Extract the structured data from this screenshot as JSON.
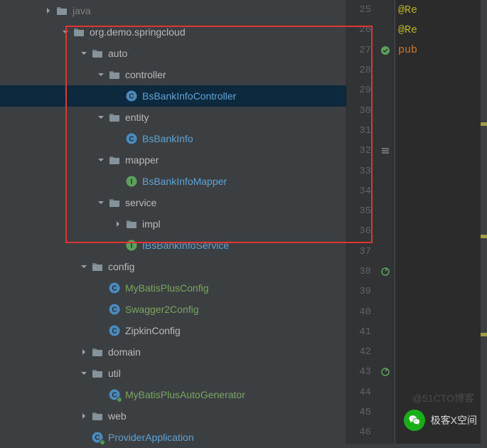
{
  "tree": {
    "rows": [
      {
        "indent": 62,
        "arrow": "right",
        "icon": "folder",
        "label": "java",
        "cls": "dim",
        "sel": false
      },
      {
        "indent": 86,
        "arrow": "down",
        "icon": "folder",
        "label": "org.demo.springcloud",
        "cls": "",
        "sel": false
      },
      {
        "indent": 112,
        "arrow": "down",
        "icon": "folder",
        "label": "auto",
        "cls": "",
        "sel": false
      },
      {
        "indent": 136,
        "arrow": "down",
        "icon": "folder",
        "label": "controller",
        "cls": "",
        "sel": false
      },
      {
        "indent": 160,
        "arrow": "none",
        "icon": "class",
        "label": "BsBankInfoController",
        "cls": "svc",
        "sel": true
      },
      {
        "indent": 136,
        "arrow": "down",
        "icon": "folder",
        "label": "entity",
        "cls": "",
        "sel": false
      },
      {
        "indent": 160,
        "arrow": "none",
        "icon": "class",
        "label": "BsBankInfo",
        "cls": "svc",
        "sel": false
      },
      {
        "indent": 136,
        "arrow": "down",
        "icon": "folder",
        "label": "mapper",
        "cls": "",
        "sel": false
      },
      {
        "indent": 160,
        "arrow": "none",
        "icon": "iface",
        "label": "BsBankInfoMapper",
        "cls": "svc",
        "sel": false
      },
      {
        "indent": 136,
        "arrow": "down",
        "icon": "folder",
        "label": "service",
        "cls": "",
        "sel": false
      },
      {
        "indent": 160,
        "arrow": "right",
        "icon": "folder",
        "label": "impl",
        "cls": "",
        "sel": false
      },
      {
        "indent": 160,
        "arrow": "none",
        "icon": "iface",
        "label": "IBsBankInfoService",
        "cls": "svc",
        "sel": false
      },
      {
        "indent": 112,
        "arrow": "down",
        "icon": "folder",
        "label": "config",
        "cls": "",
        "sel": false
      },
      {
        "indent": 136,
        "arrow": "none",
        "icon": "class",
        "label": "MyBatisPlusConfig",
        "cls": "green",
        "sel": false
      },
      {
        "indent": 136,
        "arrow": "none",
        "icon": "class",
        "label": "Swagger2Config",
        "cls": "green",
        "sel": false
      },
      {
        "indent": 136,
        "arrow": "none",
        "icon": "class",
        "label": "ZipkinConfig",
        "cls": "",
        "sel": false
      },
      {
        "indent": 112,
        "arrow": "right",
        "icon": "folder",
        "label": "domain",
        "cls": "",
        "sel": false
      },
      {
        "indent": 112,
        "arrow": "down",
        "icon": "folder",
        "label": "util",
        "cls": "",
        "sel": false
      },
      {
        "indent": 136,
        "arrow": "none",
        "icon": "class-run",
        "label": "MyBatisPlusAutoGenerator",
        "cls": "green",
        "sel": false
      },
      {
        "indent": 112,
        "arrow": "right",
        "icon": "folder",
        "label": "web",
        "cls": "",
        "sel": false
      },
      {
        "indent": 112,
        "arrow": "none",
        "icon": "class-run",
        "label": "ProviderApplication",
        "cls": "svc",
        "sel": false
      }
    ]
  },
  "lines": [
    25,
    26,
    27,
    28,
    29,
    30,
    31,
    32,
    33,
    34,
    35,
    36,
    37,
    38,
    39,
    40,
    41,
    42,
    43,
    44,
    45,
    46
  ],
  "gutter": {
    "27": "leaf",
    "32": "expand",
    "38": "recycle",
    "43": "recycle"
  },
  "code": {
    "25": {
      "text": "@Re",
      "cls": "yellow"
    },
    "26": {
      "text": "@Re",
      "cls": "yellow"
    },
    "27": {
      "text": "pub",
      "cls": "orange"
    }
  },
  "watermark": {
    "label": "极客X空间"
  },
  "faded": "@51CTO博客"
}
